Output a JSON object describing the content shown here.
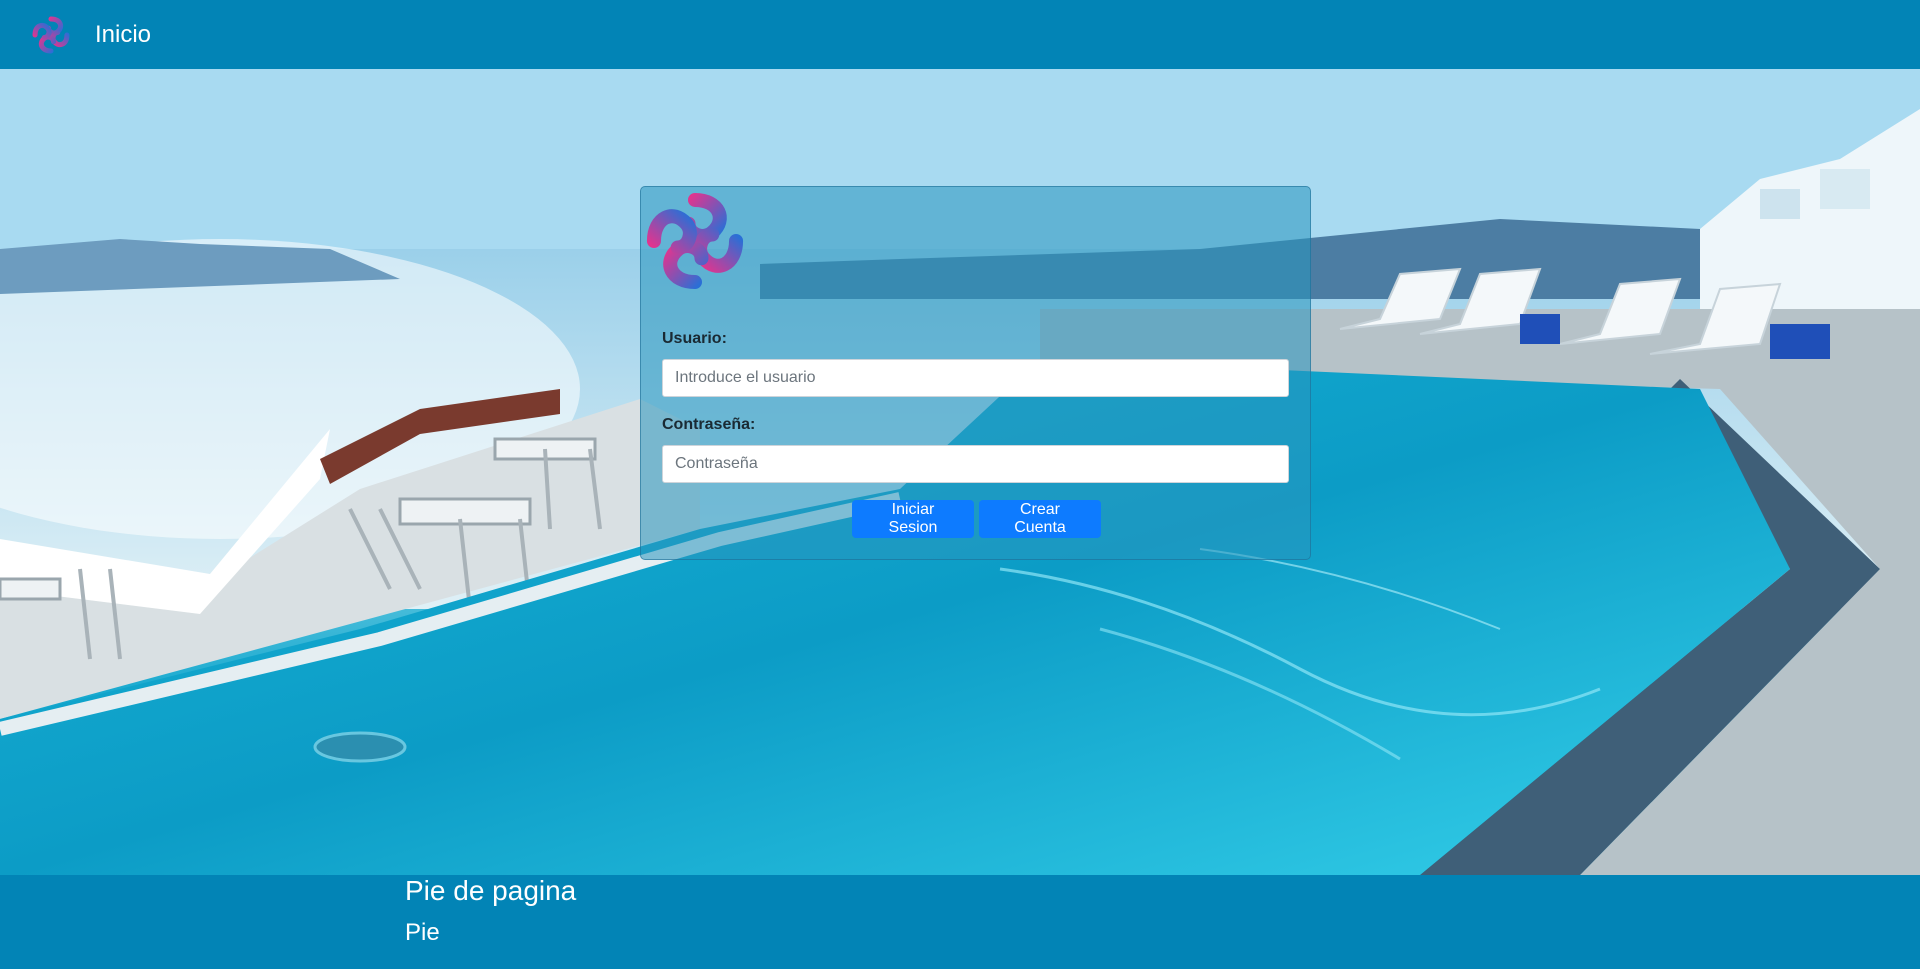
{
  "navbar": {
    "title": "Inicio",
    "logo_icon": "knot-logo-icon"
  },
  "login": {
    "logo_icon": "knot-logo-icon",
    "user_label": "Usuario:",
    "user_placeholder": "Introduce el usuario",
    "user_value": "",
    "pass_label": "Contraseña:",
    "pass_placeholder": "Contraseña",
    "pass_value": "",
    "login_button": "Iniciar Sesion",
    "create_button": "Crear Cuenta"
  },
  "footer": {
    "title": "Pie de pagina",
    "text": "Pie"
  },
  "colors": {
    "brand": "#0284b6",
    "primary_button": "#0d7bff",
    "logo_pink": "#e0358f",
    "logo_blue": "#2a6fd6"
  }
}
